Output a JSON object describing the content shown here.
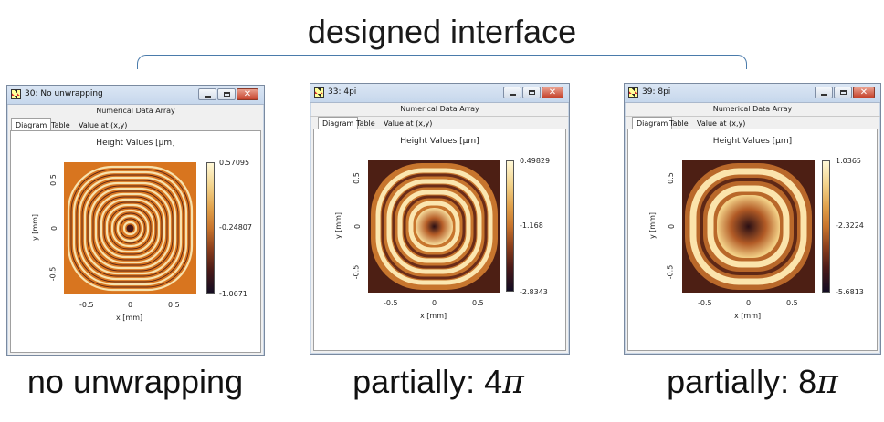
{
  "headline": "designed interface",
  "colors": {
    "bracket": "#4a7bab",
    "flat_orange": "#d8751f",
    "dark_bg": "#4d1f14",
    "window_border": "#7a8aa0"
  },
  "windows": [
    {
      "title": "30: No unwrapping",
      "subtitle": "Numerical Data Array",
      "tabs": [
        "Diagram",
        "Table",
        "Value at (x,y)"
      ],
      "active_tab": "Diagram",
      "plot_title": "Height Values  [µm]",
      "colorbar": {
        "max": "0.57095",
        "mid": "-0.24807",
        "min": "-1.0671"
      },
      "x_ticks": [
        "-0.5",
        "0",
        "0.5"
      ],
      "y_ticks": [
        "0.5",
        "0",
        "-0.5"
      ],
      "xlabel": "x [mm]",
      "ylabel": "y [mm]",
      "caption": "no unwrapping",
      "caption_pi": "",
      "icons": [
        "app-icon",
        "minimize-icon",
        "maximize-icon",
        "close-icon"
      ]
    },
    {
      "title": "33: 4pi",
      "subtitle": "Numerical Data Array",
      "tabs": [
        "Diagram",
        "Table",
        "Value at (x,y)"
      ],
      "active_tab": "Diagram",
      "plot_title": "Height Values  [µm]",
      "colorbar": {
        "max": "0.49829",
        "mid": "-1.168",
        "min": "-2.8343"
      },
      "x_ticks": [
        "-0.5",
        "0",
        "0.5"
      ],
      "y_ticks": [
        "0.5",
        "0",
        "-0.5"
      ],
      "xlabel": "x [mm]",
      "ylabel": "y [mm]",
      "caption": "partially: 4",
      "caption_pi": "π",
      "icons": [
        "app-icon",
        "minimize-icon",
        "maximize-icon",
        "close-icon"
      ]
    },
    {
      "title": "39: 8pi",
      "subtitle": "Numerical Data Array",
      "tabs": [
        "Diagram",
        "Table",
        "Value at (x,y)"
      ],
      "active_tab": "Diagram",
      "plot_title": "Height Values  [µm]",
      "colorbar": {
        "max": "1.0365",
        "mid": "-2.3224",
        "min": "-5.6813"
      },
      "x_ticks": [
        "-0.5",
        "0",
        "0.5"
      ],
      "y_ticks": [
        "0.5",
        "0",
        "-0.5"
      ],
      "xlabel": "x [mm]",
      "ylabel": "y [mm]",
      "caption": "partially: 8",
      "caption_pi": "π",
      "icons": [
        "app-icon",
        "minimize-icon",
        "maximize-icon",
        "close-icon"
      ]
    }
  ],
  "window_controls": {
    "close_glyph": "✕"
  }
}
